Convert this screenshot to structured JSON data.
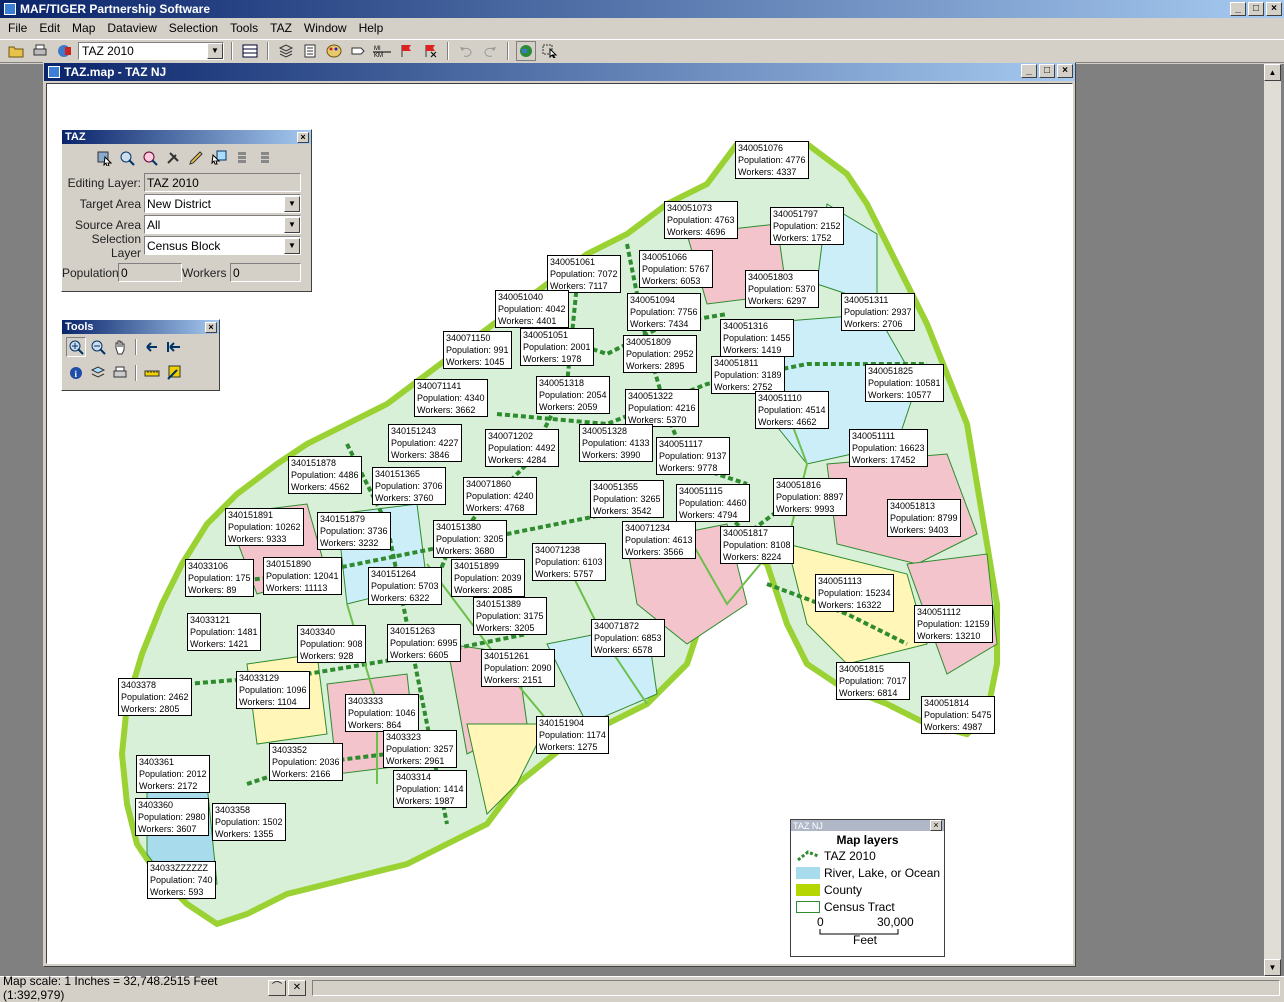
{
  "app": {
    "title": "MAF/TIGER Partnership Software"
  },
  "window_controls": {
    "minimize": "_",
    "maximize": "□",
    "close": "×"
  },
  "menu": [
    "File",
    "Edit",
    "Map",
    "Dataview",
    "Selection",
    "Tools",
    "TAZ",
    "Window",
    "Help"
  ],
  "toolbar": {
    "layer_value": "TAZ 2010"
  },
  "map_window": {
    "title": "TAZ.map - TAZ NJ"
  },
  "taz_panel": {
    "title": "TAZ",
    "editing_layer_label": "Editing Layer:",
    "editing_layer_value": "TAZ 2010",
    "target_area_label": "Target Area",
    "target_area_value": "New District",
    "source_area_label": "Source Area",
    "source_area_value": "All",
    "selection_layer_label": "Selection Layer",
    "selection_layer_value": "Census Block",
    "population_label": "Population",
    "population_value": "0",
    "workers_label": "Workers",
    "workers_value": "0"
  },
  "tools_panel": {
    "title": "Tools"
  },
  "legend": {
    "window_title": "TAZ NJ",
    "heading": "Map layers",
    "items": [
      {
        "label": "TAZ 2010",
        "color": "#2e8b2e"
      },
      {
        "label": "River, Lake, or Ocean",
        "color": "#a8dcec"
      },
      {
        "label": "County",
        "color": "#b5d600"
      },
      {
        "label": "Census Tract",
        "color": "#ffffff"
      }
    ],
    "scale_zero": "0",
    "scale_max": "30,000",
    "scale_unit": "Feet"
  },
  "taz_labels": [
    {
      "id": "340051076",
      "pop": "4776",
      "wrk": "4337"
    },
    {
      "id": "340051073",
      "pop": "4763",
      "wrk": "4696"
    },
    {
      "id": "340051797",
      "pop": "2152",
      "wrk": "1752"
    },
    {
      "id": "340051061",
      "pop": "7072",
      "wrk": "7117"
    },
    {
      "id": "340051066",
      "pop": "5767",
      "wrk": "6053"
    },
    {
      "id": "340051803",
      "pop": "5370",
      "wrk": "6297"
    },
    {
      "id": "340051040",
      "pop": "4042",
      "wrk": "4401"
    },
    {
      "id": "340051094",
      "pop": "7756",
      "wrk": "7434"
    },
    {
      "id": "340051311",
      "pop": "2937",
      "wrk": "2706"
    },
    {
      "id": "340071150",
      "pop": "991",
      "wrk": "1045"
    },
    {
      "id": "340051051",
      "pop": "2001",
      "wrk": "1978"
    },
    {
      "id": "340051809",
      "pop": "2952",
      "wrk": "2895"
    },
    {
      "id": "340051316",
      "pop": "1455",
      "wrk": "1419"
    },
    {
      "id": "340051811",
      "pop": "3189",
      "wrk": "2752"
    },
    {
      "id": "340051825",
      "pop": "10581",
      "wrk": "10577"
    },
    {
      "id": "340071141",
      "pop": "4340",
      "wrk": "3662"
    },
    {
      "id": "340051318",
      "pop": "2054",
      "wrk": "2059"
    },
    {
      "id": "340051322",
      "pop": "4216",
      "wrk": "5370"
    },
    {
      "id": "340051110",
      "pop": "4514",
      "wrk": "4662"
    },
    {
      "id": "340151243",
      "pop": "4227",
      "wrk": "3846"
    },
    {
      "id": "340071202",
      "pop": "4492",
      "wrk": "4284"
    },
    {
      "id": "340051328",
      "pop": "4133",
      "wrk": "3990"
    },
    {
      "id": "340051117",
      "pop": "9137",
      "wrk": "9778"
    },
    {
      "id": "340051111",
      "pop": "16623",
      "wrk": "17452"
    },
    {
      "id": "340151878",
      "pop": "4486",
      "wrk": "4562"
    },
    {
      "id": "340151365",
      "pop": "3706",
      "wrk": "3760"
    },
    {
      "id": "340071860",
      "pop": "4240",
      "wrk": "4768"
    },
    {
      "id": "340051355",
      "pop": "3265",
      "wrk": "3542"
    },
    {
      "id": "340051115",
      "pop": "4460",
      "wrk": "4794"
    },
    {
      "id": "340051816",
      "pop": "8897",
      "wrk": "9993"
    },
    {
      "id": "340151891",
      "pop": "10262",
      "wrk": "9333"
    },
    {
      "id": "340151879",
      "pop": "3736",
      "wrk": "3232"
    },
    {
      "id": "340151380",
      "pop": "3205",
      "wrk": "3680"
    },
    {
      "id": "340071234",
      "pop": "4613",
      "wrk": "3566"
    },
    {
      "id": "340051813",
      "pop": "8799",
      "wrk": "9403"
    },
    {
      "id": "340051817",
      "pop": "8108",
      "wrk": "8224"
    },
    {
      "id": "34033106",
      "pop": "175",
      "wrk": "89"
    },
    {
      "id": "340151890",
      "pop": "12041",
      "wrk": "11113"
    },
    {
      "id": "340071238",
      "pop": "6103",
      "wrk": "5757"
    },
    {
      "id": "340151264",
      "pop": "5703",
      "wrk": "6322"
    },
    {
      "id": "340151899",
      "pop": "2039",
      "wrk": "2085"
    },
    {
      "id": "340051113",
      "pop": "15234",
      "wrk": "16322"
    },
    {
      "id": "34033121",
      "pop": "1481",
      "wrk": "1421"
    },
    {
      "id": "340151389",
      "pop": "3175",
      "wrk": "3205"
    },
    {
      "id": "340051112",
      "pop": "12159",
      "wrk": "13210"
    },
    {
      "id": "3403340",
      "pop": "908",
      "wrk": "928"
    },
    {
      "id": "340151263",
      "pop": "6995",
      "wrk": "6605"
    },
    {
      "id": "340071872",
      "pop": "6853",
      "wrk": "6578"
    },
    {
      "id": "340151261",
      "pop": "2090",
      "wrk": "2151"
    },
    {
      "id": "3403378",
      "pop": "2462",
      "wrk": "2805"
    },
    {
      "id": "34033129",
      "pop": "1096",
      "wrk": "1104"
    },
    {
      "id": "340051815",
      "pop": "7017",
      "wrk": "6814"
    },
    {
      "id": "3403333",
      "pop": "1046",
      "wrk": "864"
    },
    {
      "id": "340051814",
      "pop": "5475",
      "wrk": "4987"
    },
    {
      "id": "340151904",
      "pop": "1174",
      "wrk": "1275"
    },
    {
      "id": "3403352",
      "pop": "2036",
      "wrk": "2166"
    },
    {
      "id": "3403323",
      "pop": "3257",
      "wrk": "2961"
    },
    {
      "id": "3403361",
      "pop": "2012",
      "wrk": "2172"
    },
    {
      "id": "3403314",
      "pop": "1414",
      "wrk": "1987"
    },
    {
      "id": "3403360",
      "pop": "2980",
      "wrk": "3607"
    },
    {
      "id": "3403358",
      "pop": "1502",
      "wrk": "1355"
    },
    {
      "id": "34033ZZZZZZ",
      "pop": "740",
      "wrk": "593"
    }
  ],
  "label_prefix": {
    "pop": "Population: ",
    "wrk": "Workers: "
  },
  "status": {
    "scale_text": "Map scale: 1 Inches = 32,748.2515 Feet (1:392,979)"
  }
}
